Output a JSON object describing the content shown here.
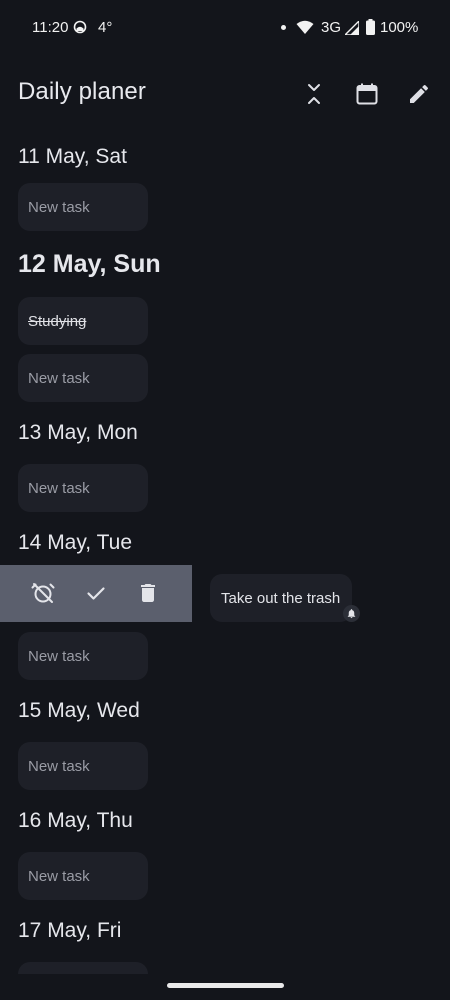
{
  "status_bar": {
    "time": "11:20",
    "temperature": "4°",
    "network": "3G",
    "battery": "100%"
  },
  "app_bar": {
    "title": "Daily planer",
    "actions": [
      "collapse-icon",
      "calendar-icon",
      "edit-icon"
    ]
  },
  "days": [
    {
      "header": "11 May, Sat",
      "new_task_placeholder": "New task"
    },
    {
      "header": "12 May, Sun",
      "is_today": true,
      "tasks": [
        {
          "text": "Studying",
          "completed": true
        }
      ],
      "new_task_placeholder": "New task"
    },
    {
      "header": "13 May, Mon",
      "new_task_placeholder": "New task"
    },
    {
      "header": "14 May, Tue",
      "tasks": [
        {
          "text": "Take out the trash",
          "has_reminder": true,
          "swiped": true
        }
      ],
      "new_task_placeholder": "New task"
    },
    {
      "header": "15 May, Wed",
      "new_task_placeholder": "New task"
    },
    {
      "header": "16 May, Thu",
      "new_task_placeholder": "New task"
    },
    {
      "header": "17 May, Fri"
    }
  ],
  "swipe_actions": [
    "alarm-off-icon",
    "check-icon",
    "delete-icon"
  ],
  "colors": {
    "background": "#13151b",
    "card": "#1e2028",
    "action_bar": "#5b5f6d"
  }
}
